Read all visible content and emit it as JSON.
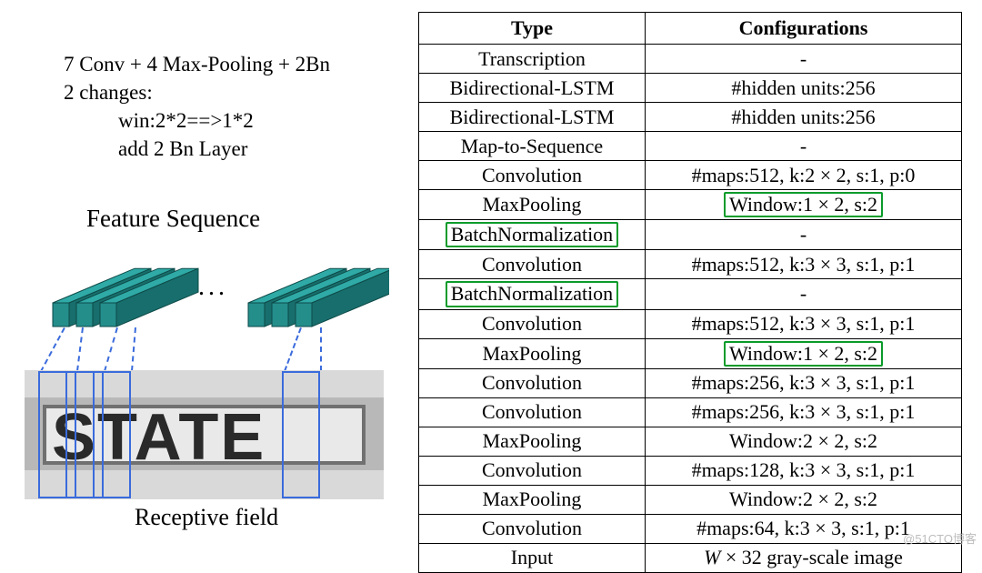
{
  "notes": {
    "line1": "7 Conv + 4 Max-Pooling + 2Bn",
    "line2": "2 changes:",
    "line3": "win:2*2==>1*2",
    "line4": "add 2 Bn Layer"
  },
  "feature_title": "Feature Sequence",
  "dots": "...",
  "receptive_label": "Receptive field",
  "sign_text": "STATE",
  "table": {
    "headers": [
      "Type",
      "Configurations"
    ],
    "rows": [
      {
        "type": "Transcription",
        "config": "-",
        "hl_type": false,
        "hl_config": false
      },
      {
        "type": "Bidirectional-LSTM",
        "config": "#hidden units:256",
        "hl_type": false,
        "hl_config": false
      },
      {
        "type": "Bidirectional-LSTM",
        "config": "#hidden units:256",
        "hl_type": false,
        "hl_config": false
      },
      {
        "type": "Map-to-Sequence",
        "config": "-",
        "hl_type": false,
        "hl_config": false
      },
      {
        "type": "Convolution",
        "config": "#maps:512, k:2 × 2, s:1, p:0",
        "hl_type": false,
        "hl_config": false
      },
      {
        "type": "MaxPooling",
        "config": "Window:1 × 2, s:2",
        "hl_type": false,
        "hl_config": true
      },
      {
        "type": "BatchNormalization",
        "config": "-",
        "hl_type": true,
        "hl_config": false
      },
      {
        "type": "Convolution",
        "config": "#maps:512, k:3 × 3, s:1, p:1",
        "hl_type": false,
        "hl_config": false
      },
      {
        "type": "BatchNormalization",
        "config": "-",
        "hl_type": true,
        "hl_config": false
      },
      {
        "type": "Convolution",
        "config": "#maps:512, k:3 × 3, s:1, p:1",
        "hl_type": false,
        "hl_config": false
      },
      {
        "type": "MaxPooling",
        "config": "Window:1 × 2, s:2",
        "hl_type": false,
        "hl_config": true
      },
      {
        "type": "Convolution",
        "config": "#maps:256, k:3 × 3, s:1, p:1",
        "hl_type": false,
        "hl_config": false
      },
      {
        "type": "Convolution",
        "config": "#maps:256, k:3 × 3, s:1, p:1",
        "hl_type": false,
        "hl_config": false
      },
      {
        "type": "MaxPooling",
        "config": "Window:2 × 2, s:2",
        "hl_type": false,
        "hl_config": false
      },
      {
        "type": "Convolution",
        "config": "#maps:128, k:3 × 3, s:1, p:1",
        "hl_type": false,
        "hl_config": false
      },
      {
        "type": "MaxPooling",
        "config": "Window:2 × 2, s:2",
        "hl_type": false,
        "hl_config": false
      },
      {
        "type": "Convolution",
        "config": "#maps:64, k:3 × 3, s:1, p:1",
        "hl_type": false,
        "hl_config": false
      },
      {
        "type": "Input",
        "config_html": "<i>W</i> × 32 gray-scale image",
        "hl_type": false,
        "hl_config": false
      }
    ]
  },
  "colors": {
    "teal_face": "#248e8b",
    "teal_top": "#2faaa6",
    "teal_side": "#186e6c",
    "highlight_green": "#0a9b2a",
    "blue": "#3a6bdc"
  },
  "watermark": "@51CTO博客"
}
